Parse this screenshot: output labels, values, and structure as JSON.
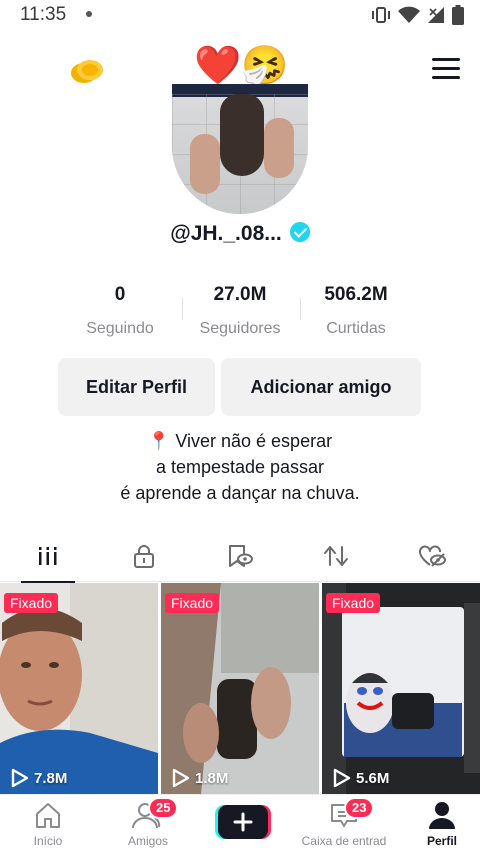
{
  "status_bar": {
    "time": "11:35"
  },
  "profile": {
    "username": "@JH._.08...",
    "deco_emoji": "❤️🤧",
    "stats": [
      {
        "value": "0",
        "label": "Seguindo"
      },
      {
        "value": "27.0M",
        "label": "Seguidores"
      },
      {
        "value": "506.2M",
        "label": "Curtidas"
      }
    ],
    "buttons": {
      "edit": "Editar Perfil",
      "add_friend": "Adicionar amigo"
    },
    "bio": {
      "line1": "📍 Viver não é esperar",
      "line2": "a tempestade passar",
      "line3": "é aprende a dançar na chuva."
    }
  },
  "tabs": [
    "videos-grid-icon",
    "lock-icon",
    "bookmark-eye-icon",
    "repost-icon",
    "liked-hidden-icon"
  ],
  "videos": [
    {
      "pin_label": "Fixado",
      "views": "7.8M"
    },
    {
      "pin_label": "Fixado",
      "views": "1.8M"
    },
    {
      "pin_label": "Fixado",
      "views": "5.6M"
    }
  ],
  "bottom_nav": {
    "home": "Início",
    "friends": "Amigos",
    "friends_badge": "25",
    "inbox": "Caixa de entrad",
    "inbox_badge": "23",
    "profile": "Perfil"
  },
  "colors": {
    "accent": "#fe2c55",
    "verified": "#20d5ec",
    "cyan": "#25f4ee",
    "text": "#161823",
    "muted": "#8a8b91"
  }
}
